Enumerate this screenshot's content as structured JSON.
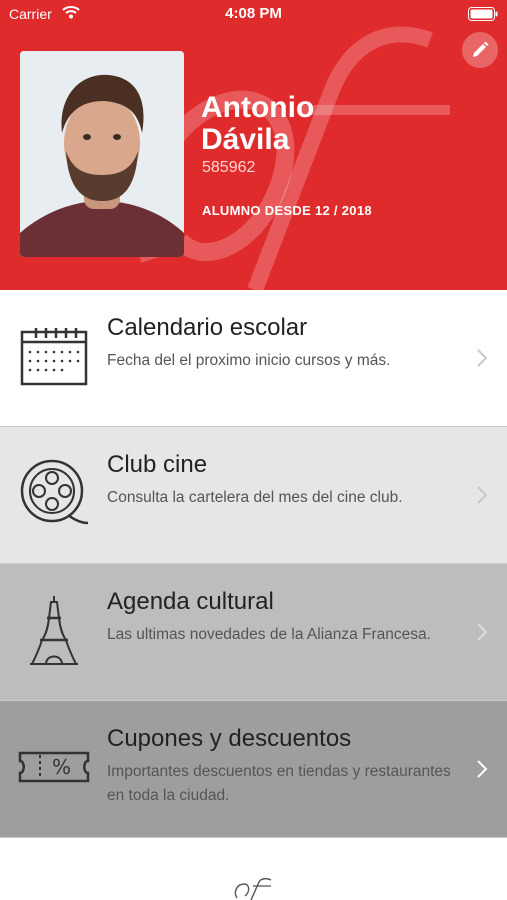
{
  "status_bar": {
    "carrier": "Carrier",
    "time": "4:08 PM"
  },
  "profile": {
    "first_name": "Antonio",
    "last_name": "Dávila",
    "student_id": "585962",
    "since": "ALUMNO DESDE 12 / 2018",
    "accent_color": "#e02b2c"
  },
  "menu": [
    {
      "title": "Calendario escolar",
      "description": "Fecha del el proximo inicio cursos y más.",
      "icon": "calendar-icon"
    },
    {
      "title": "Club cine",
      "description": "Consulta la cartelera del mes del cine club.",
      "icon": "film-reel-icon"
    },
    {
      "title": "Agenda cultural",
      "description": "Las ultimas novedades de la Alianza Francesa.",
      "icon": "eiffel-tower-icon"
    },
    {
      "title": "Cupones y descuentos",
      "description": "Importantes descuentos en tiendas y restaurantes en toda la ciudad.",
      "icon": "coupon-icon"
    }
  ]
}
